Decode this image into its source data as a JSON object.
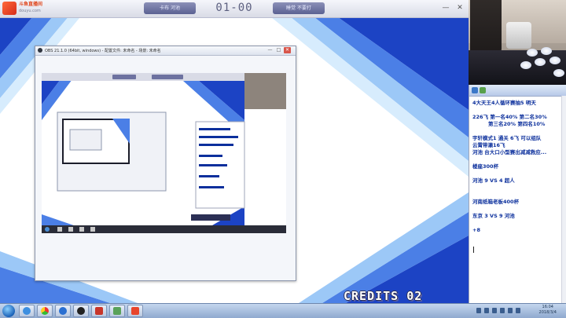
{
  "scoreboard": {
    "brand_name": "斗鱼直播间",
    "brand_sub": "douyu.com",
    "player_left": "卡布 河池",
    "score": "01-00",
    "player_right": "睡觉 不要打",
    "minimize_label": "—",
    "close_label": "✕"
  },
  "obs": {
    "title": "OBS 21.1.0 (64bit, windows) - 配置文件: 未命名 - 场景: 未命名"
  },
  "chat": {
    "lines": [
      "4大天王4人循环赛抽5  明天",
      "",
      "226飞  第一名40%  第二名30%",
      "第三名20%  第四名10%",
      "",
      "宇轩模式1  通关  6飞  可以组队",
      "云霄带濑16飞",
      "河池  台大口小型赛出减减救应...",
      "",
      "楼座300杯",
      "",
      "河池 9 VS 4 超人",
      "",
      "",
      "河南纸箱老板400杯",
      "",
      "东京 3 VS 9 河池",
      "",
      "+8"
    ]
  },
  "credits": "CREDITS 02",
  "taskbar": {
    "time": "16:04",
    "date": "2018/3/4"
  },
  "colors": {
    "stripe_dark": "#1c43c4",
    "stripe_mid": "#4b7fe6",
    "stripe_light": "#9cc8f7",
    "chat_text": "#0b2f9c"
  }
}
